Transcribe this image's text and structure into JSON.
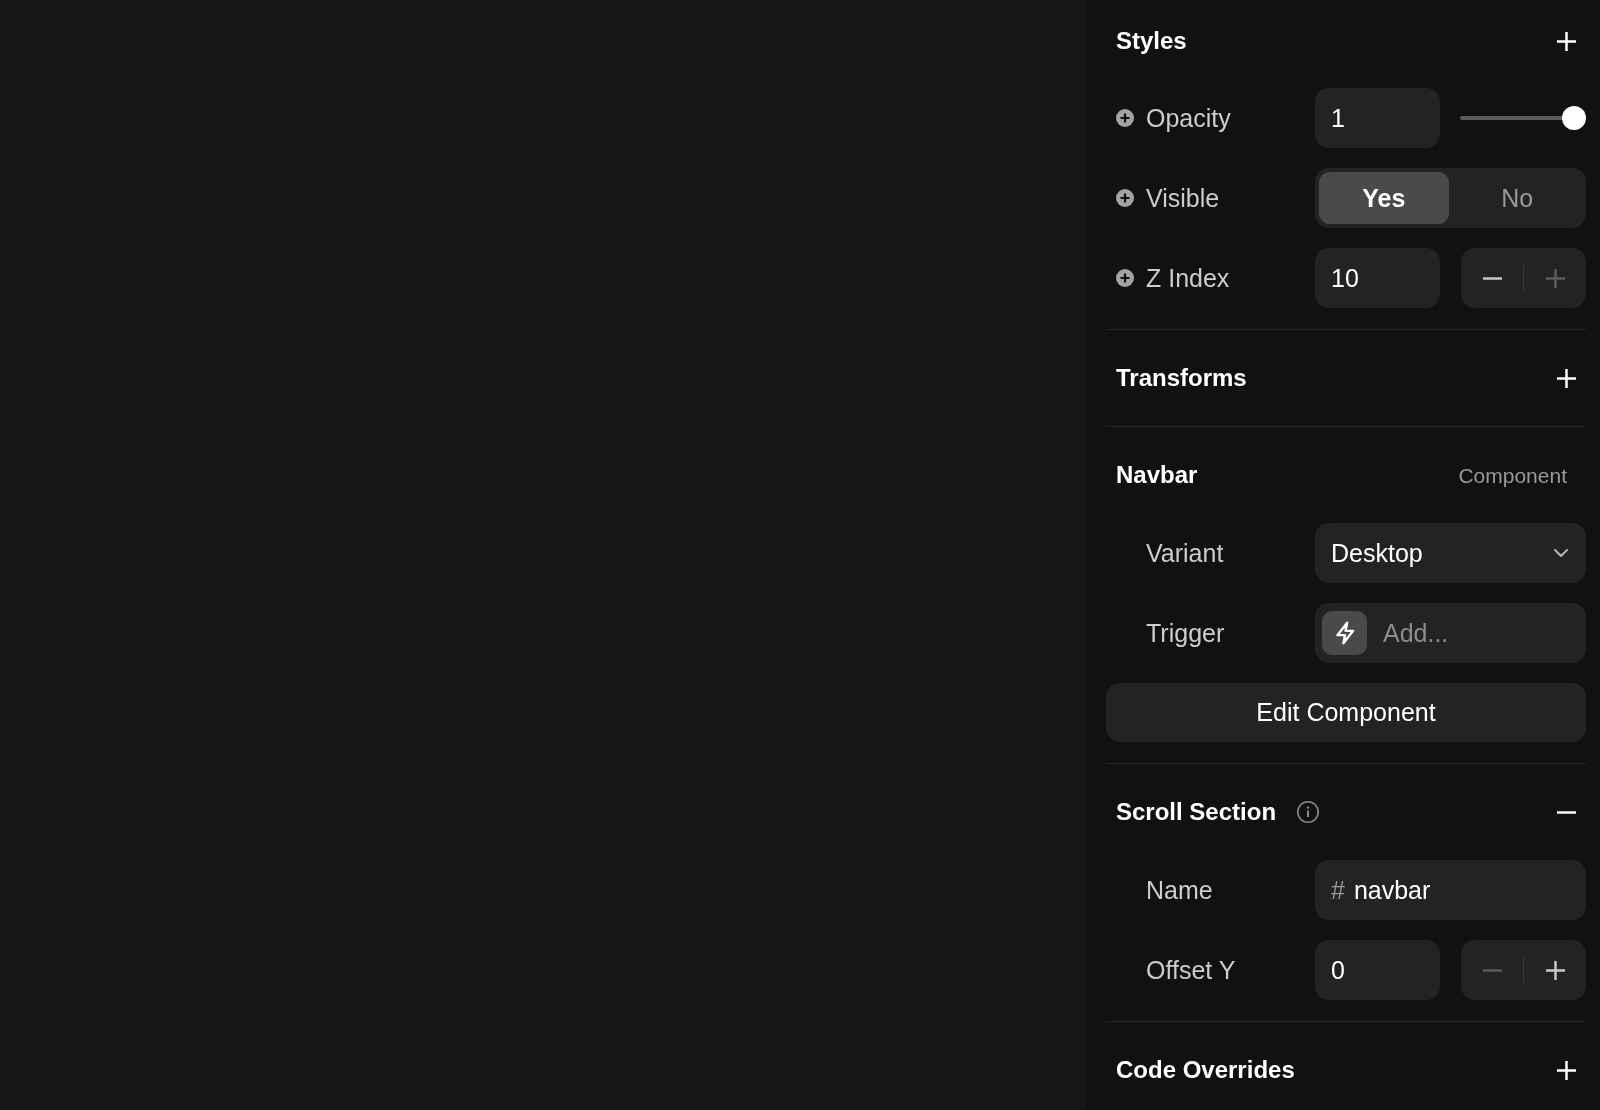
{
  "sections": [
    {
      "title": "Styles",
      "can_add": true,
      "can_remove": false,
      "has_info": false,
      "rows": [
        {
          "kind": "slider",
          "label": "Opacity",
          "addable": true,
          "value": "1",
          "level": 1
        },
        {
          "kind": "toggle",
          "label": "Visible",
          "addable": true,
          "options": [
            {
              "label": "Yes",
              "selected": true
            },
            {
              "label": "No",
              "selected": false
            }
          ]
        },
        {
          "kind": "stepper",
          "label": "Z Index",
          "addable": true,
          "value": "10",
          "decrement_disabled": false,
          "increment_disabled": true
        }
      ]
    },
    {
      "title": "Transforms",
      "can_add": true,
      "can_remove": false,
      "has_info": false
    },
    {
      "title": "Navbar",
      "badge": "Component",
      "can_add": false,
      "can_remove": false,
      "has_info": false,
      "rows": [
        {
          "kind": "select",
          "label": "Variant",
          "addable": false,
          "value": "Desktop"
        },
        {
          "kind": "trigger",
          "label": "Trigger",
          "addable": false,
          "placeholder": "Add..."
        }
      ],
      "button": "Edit Component"
    },
    {
      "title": "Scroll Section",
      "can_add": false,
      "can_remove": true,
      "has_info": true,
      "rows": [
        {
          "kind": "id",
          "label": "Name",
          "addable": false,
          "prefix": "#",
          "value": "navbar"
        },
        {
          "kind": "stepper",
          "label": "Offset Y",
          "addable": false,
          "value": "0",
          "decrement_disabled": true,
          "increment_disabled": false
        }
      ]
    },
    {
      "title": "Code Overrides",
      "can_add": true,
      "can_remove": false,
      "has_info": false
    }
  ]
}
